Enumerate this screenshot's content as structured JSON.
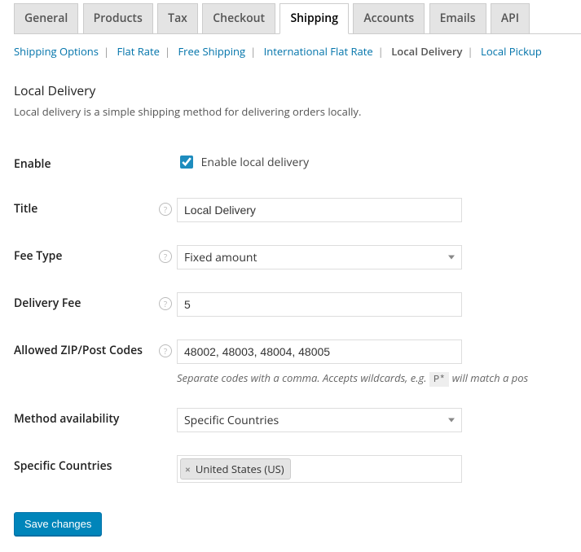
{
  "tabs": {
    "items": [
      {
        "label": "General"
      },
      {
        "label": "Products"
      },
      {
        "label": "Tax"
      },
      {
        "label": "Checkout"
      },
      {
        "label": "Shipping"
      },
      {
        "label": "Accounts"
      },
      {
        "label": "Emails"
      },
      {
        "label": "API"
      }
    ],
    "active_index": 4
  },
  "subnav": {
    "items": [
      {
        "label": "Shipping Options"
      },
      {
        "label": "Flat Rate"
      },
      {
        "label": "Free Shipping"
      },
      {
        "label": "International Flat Rate"
      },
      {
        "label": "Local Delivery"
      },
      {
        "label": "Local Pickup"
      }
    ],
    "current_index": 4
  },
  "section": {
    "title": "Local Delivery",
    "description": "Local delivery is a simple shipping method for delivering orders locally."
  },
  "fields": {
    "enable": {
      "label": "Enable",
      "checkbox_label": "Enable local delivery",
      "checked": true
    },
    "title": {
      "label": "Title",
      "value": "Local Delivery"
    },
    "fee_type": {
      "label": "Fee Type",
      "value": "Fixed amount"
    },
    "delivery_fee": {
      "label": "Delivery Fee",
      "value": "5"
    },
    "allowed_zip": {
      "label": "Allowed ZIP/Post Codes",
      "value": "48002, 48003, 48004, 48005",
      "hint_before": "Separate codes with a comma. Accepts wildcards, e.g.",
      "hint_code": "P*",
      "hint_after": "will match a pos"
    },
    "availability": {
      "label": "Method availability",
      "value": "Specific Countries"
    },
    "specific_countries": {
      "label": "Specific Countries",
      "chips": [
        "United States (US)"
      ]
    }
  },
  "actions": {
    "save": "Save changes"
  }
}
